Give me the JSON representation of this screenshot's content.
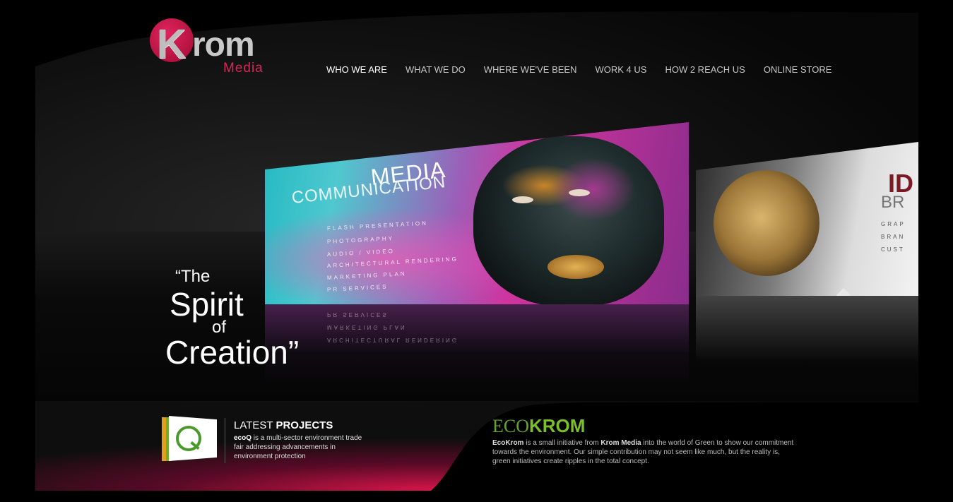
{
  "logo": {
    "letter": "K",
    "rest": "rom",
    "sub": "Media"
  },
  "nav": [
    {
      "label": "WHO WE ARE",
      "active": true
    },
    {
      "label": "WHAT WE DO"
    },
    {
      "label": "WHERE WE'VE BEEN"
    },
    {
      "label": "WORK 4 US"
    },
    {
      "label": "HOW  2 REACH US"
    },
    {
      "label": "ONLINE STORE"
    }
  ],
  "banner_main": {
    "title1": "MEDIA",
    "title2": "COMMUNICATION",
    "services": [
      "FLASH PRESENTATION",
      "PHOTOGRAPHY",
      "AUDIO / VIDEO",
      "ARCHITECTURAL RENDERING",
      "MARKETING PLAN",
      "PR SERVICES"
    ]
  },
  "banner_side": {
    "title1": "ID",
    "title2": "BR",
    "items": [
      "GRAP",
      "BRAN",
      "CUST"
    ]
  },
  "quote": {
    "line1": "“The",
    "line2": "Spirit",
    "line3": "of",
    "line4": "Creation”"
  },
  "latest_projects": {
    "title_normal": "LATEST ",
    "title_bold": "PROJECTS",
    "name": "ecoQ",
    "text": " is a multi-sector environment trade fair addressing advancements in environment protection"
  },
  "ecokrom": {
    "logo_part1": "ECO",
    "logo_part2": "KROM",
    "name": "EcoKrom",
    "text1": " is a small initiative from ",
    "org": "Krom Media",
    "text2": " into the world of Green to show our commitment towards the environment. Our simple contribution may not seem like much, but the reality is, green initiatives create ripples in the total concept."
  },
  "colors": {
    "brand": "#d2285c",
    "eco_green": "#7bbd2a",
    "background": "#000000"
  }
}
